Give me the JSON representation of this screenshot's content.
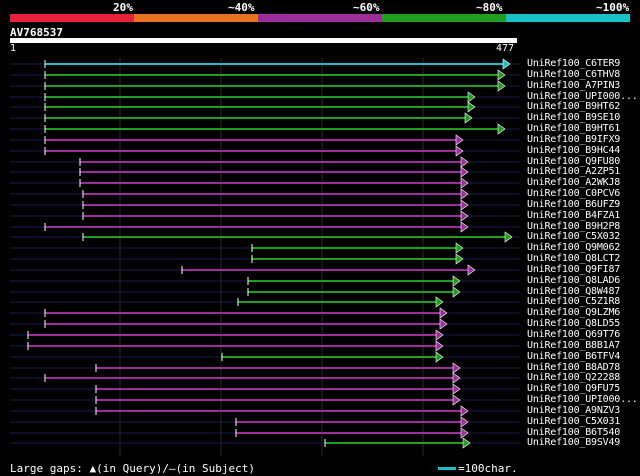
{
  "legend": {
    "colors": [
      "#e8203a",
      "#e8731e",
      "#9c2e9c",
      "#1f9e1f",
      "#19c2c8"
    ],
    "labels": [
      "20%",
      "~40%",
      "~60%",
      "~80%",
      "~100%"
    ]
  },
  "query": {
    "id": "AV768537",
    "start": "1",
    "end": "477"
  },
  "footer": {
    "gaps_text": "Large gaps: ▲(in Query)/—(in Subject)",
    "scale_text": "=100char."
  },
  "colors": {
    "cyan": "#19c2c8",
    "green": "#1f9e1f",
    "magenta": "#9c2e9c",
    "gridline": "#2a2a2a"
  },
  "hits": [
    {
      "name": "UniRef100_C6TER9",
      "color": "cyan",
      "s": 45,
      "e": 510
    },
    {
      "name": "UniRef100_C6THV8",
      "color": "green",
      "s": 45,
      "e": 505
    },
    {
      "name": "UniRef100_A7PIN3",
      "color": "green",
      "s": 45,
      "e": 505
    },
    {
      "name": "UniRef100_UPI000...",
      "color": "green",
      "s": 45,
      "e": 475
    },
    {
      "name": "UniRef100_B9HT62",
      "color": "green",
      "s": 45,
      "e": 475
    },
    {
      "name": "UniRef100_B9SE10",
      "color": "green",
      "s": 45,
      "e": 472
    },
    {
      "name": "UniRef100_B9HT61",
      "color": "green",
      "s": 45,
      "e": 505
    },
    {
      "name": "UniRef100_B9IFX9",
      "color": "magenta",
      "s": 45,
      "e": 463
    },
    {
      "name": "UniRef100_B9HC44",
      "color": "magenta",
      "s": 45,
      "e": 463
    },
    {
      "name": "UniRef100_Q9FU80",
      "color": "magenta",
      "s": 80,
      "e": 468
    },
    {
      "name": "UniRef100_A2ZP51",
      "color": "magenta",
      "s": 80,
      "e": 468
    },
    {
      "name": "UniRef100_A2WKJ8",
      "color": "magenta",
      "s": 80,
      "e": 468
    },
    {
      "name": "UniRef100_C0PCV6",
      "color": "magenta",
      "s": 83,
      "e": 468
    },
    {
      "name": "UniRef100_B6UFZ9",
      "color": "magenta",
      "s": 83,
      "e": 468
    },
    {
      "name": "UniRef100_B4FZA1",
      "color": "magenta",
      "s": 83,
      "e": 468
    },
    {
      "name": "UniRef100_B9H2P8",
      "color": "magenta",
      "s": 45,
      "e": 468
    },
    {
      "name": "UniRef100_C5X032",
      "color": "green",
      "s": 83,
      "e": 512
    },
    {
      "name": "UniRef100_Q9M062",
      "color": "green",
      "s": 252,
      "e": 463
    },
    {
      "name": "UniRef100_Q8LCT2",
      "color": "green",
      "s": 252,
      "e": 463
    },
    {
      "name": "UniRef100_Q9FI87",
      "color": "magenta",
      "s": 182,
      "e": 475
    },
    {
      "name": "UniRef100_Q8LAD6",
      "color": "green",
      "s": 248,
      "e": 460
    },
    {
      "name": "UniRef100_Q8W487",
      "color": "green",
      "s": 248,
      "e": 460
    },
    {
      "name": "UniRef100_C5Z1R8",
      "color": "green",
      "s": 238,
      "e": 443
    },
    {
      "name": "UniRef100_Q9LZM6",
      "color": "magenta",
      "s": 45,
      "e": 447
    },
    {
      "name": "UniRef100_Q8LD55",
      "color": "magenta",
      "s": 45,
      "e": 447
    },
    {
      "name": "UniRef100_Q69T76",
      "color": "magenta",
      "s": 28,
      "e": 443
    },
    {
      "name": "UniRef100_B8B1A7",
      "color": "magenta",
      "s": 28,
      "e": 443
    },
    {
      "name": "UniRef100_B6TFV4",
      "color": "green",
      "s": 222,
      "e": 443
    },
    {
      "name": "UniRef100_B8AD78",
      "color": "magenta",
      "s": 96,
      "e": 460
    },
    {
      "name": "UniRef100_Q22288",
      "color": "magenta",
      "s": 45,
      "e": 460
    },
    {
      "name": "UniRef100_Q9FU75",
      "color": "magenta",
      "s": 96,
      "e": 460
    },
    {
      "name": "UniRef100_UPI000...",
      "color": "magenta",
      "s": 96,
      "e": 460
    },
    {
      "name": "UniRef100_A9NZV3",
      "color": "magenta",
      "s": 96,
      "e": 468
    },
    {
      "name": "UniRef100_C5X031",
      "color": "magenta",
      "s": 236,
      "e": 468
    },
    {
      "name": "UniRef100_B6T540",
      "color": "magenta",
      "s": 236,
      "e": 468
    },
    {
      "name": "UniRef100_B9SV49",
      "color": "green",
      "s": 325,
      "e": 470
    }
  ]
}
